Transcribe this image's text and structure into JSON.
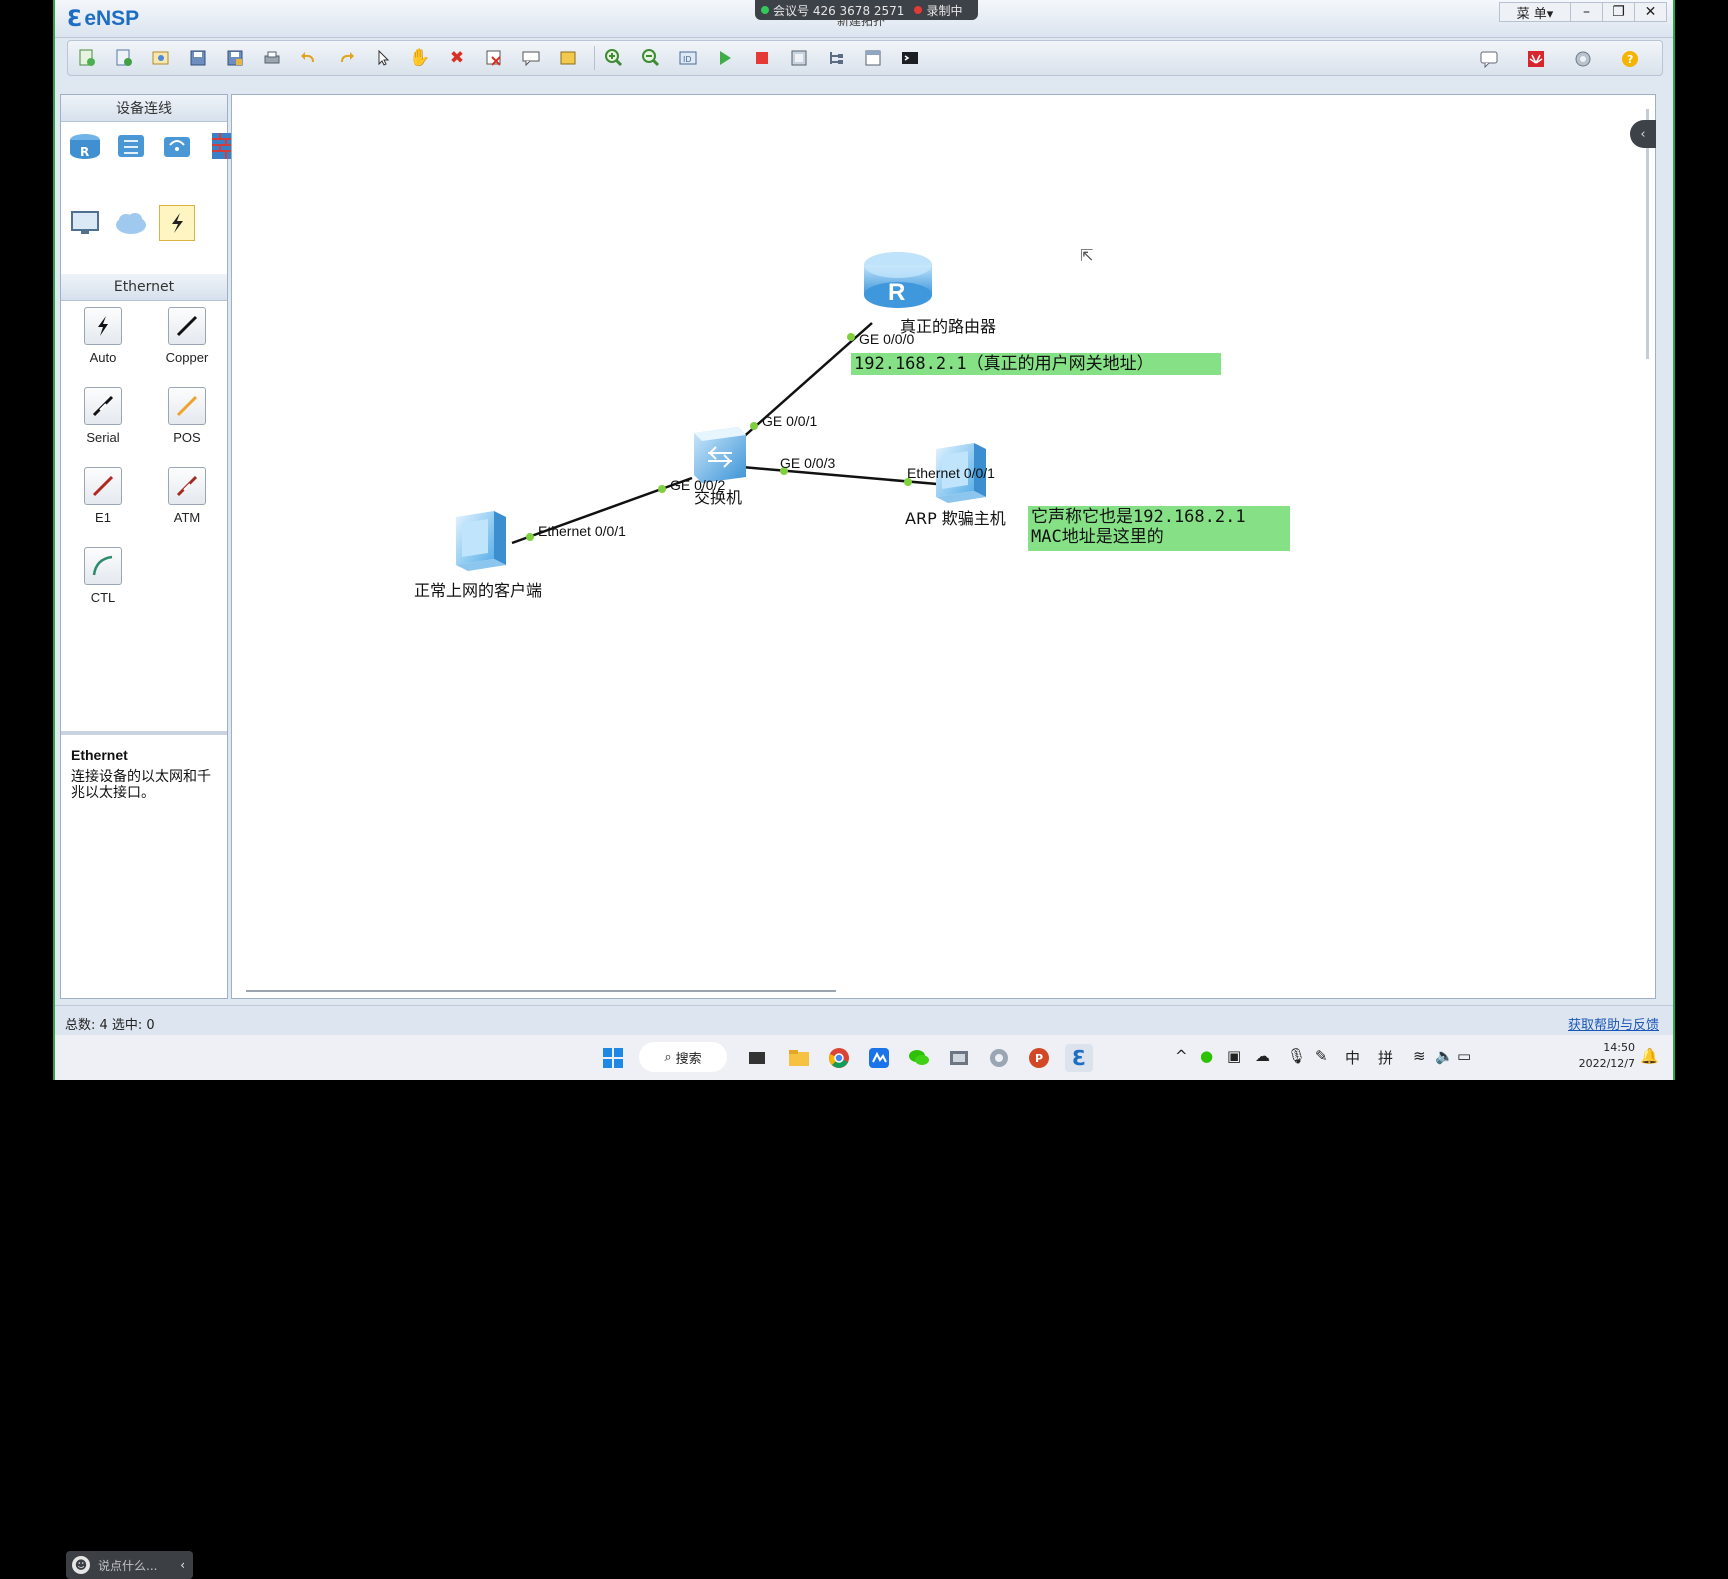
{
  "app": {
    "name": "eNSP",
    "window_title": "新建拓扑",
    "meeting_badge": "会议号 426 3678 2571",
    "recording_label": "录制中",
    "menu_label": "菜 单▾"
  },
  "toolbar": {
    "buttons": [
      "new-topology",
      "new-example",
      "open",
      "save",
      "save-as",
      "print",
      "undo",
      "redo",
      "select",
      "pan",
      "delete",
      "delete-all",
      "text",
      "palette",
      "zoom-in",
      "zoom-out",
      "capture",
      "start",
      "stop",
      "console",
      "topology",
      "fullscreen",
      "terminal"
    ],
    "right_buttons": [
      "chat",
      "huawei-logo",
      "settings",
      "help"
    ]
  },
  "left_panel": {
    "devices_title": "设备连线",
    "devices": [
      "router-icon",
      "switch-icon",
      "wireless-icon",
      "firewall-icon",
      "pc-icon",
      "cloud-icon",
      "cable-icon"
    ],
    "cables_title": "Ethernet",
    "cables": [
      {
        "label": "Auto",
        "color": "#111111",
        "icon": "auto-cable-icon"
      },
      {
        "label": "Copper",
        "color": "#111111",
        "icon": "copper-cable-icon"
      },
      {
        "label": "Serial",
        "color": "#111111",
        "icon": "serial-cable-icon"
      },
      {
        "label": "POS",
        "color": "#f0a22a",
        "icon": "pos-cable-icon"
      },
      {
        "label": "E1",
        "color": "#b5271e",
        "icon": "e1-cable-icon"
      },
      {
        "label": "ATM",
        "color": "#a42b1f",
        "icon": "atm-cable-icon"
      },
      {
        "label": "CTL",
        "color": "#2e8a6c",
        "icon": "ctl-cable-icon"
      }
    ],
    "desc_title": "Ethernet",
    "desc_text": "连接设备的以太网和千兆以太接口。",
    "chat_placeholder": "说点什么..."
  },
  "canvas": {
    "nodes": {
      "router": "真正的路由器",
      "switch": "交换机",
      "client": "正常上网的客户端",
      "attacker": "ARP 欺骗主机"
    },
    "ports": {
      "router_ge000": "GE 0/0/0",
      "switch_ge001": "GE 0/0/1",
      "switch_ge002": "GE 0/0/2",
      "switch_ge003": "GE 0/0/3",
      "client_eth": "Ethernet 0/0/1",
      "attacker_eth": "Ethernet 0/0/1"
    },
    "notes": {
      "gateway": "192.168.2.1（真正的用户网关地址）",
      "spoof_line1": "它声称它也是192.168.2.1",
      "spoof_line2": "MAC地址是这里的"
    },
    "note_color": "#86e186"
  },
  "status": {
    "left": "总数: 4  选中: 0",
    "right": "获取帮助与反馈"
  },
  "taskbar": {
    "search": "搜索",
    "ime1": "中",
    "ime2": "拼",
    "time": "14:50",
    "date": "2022/12/7"
  }
}
